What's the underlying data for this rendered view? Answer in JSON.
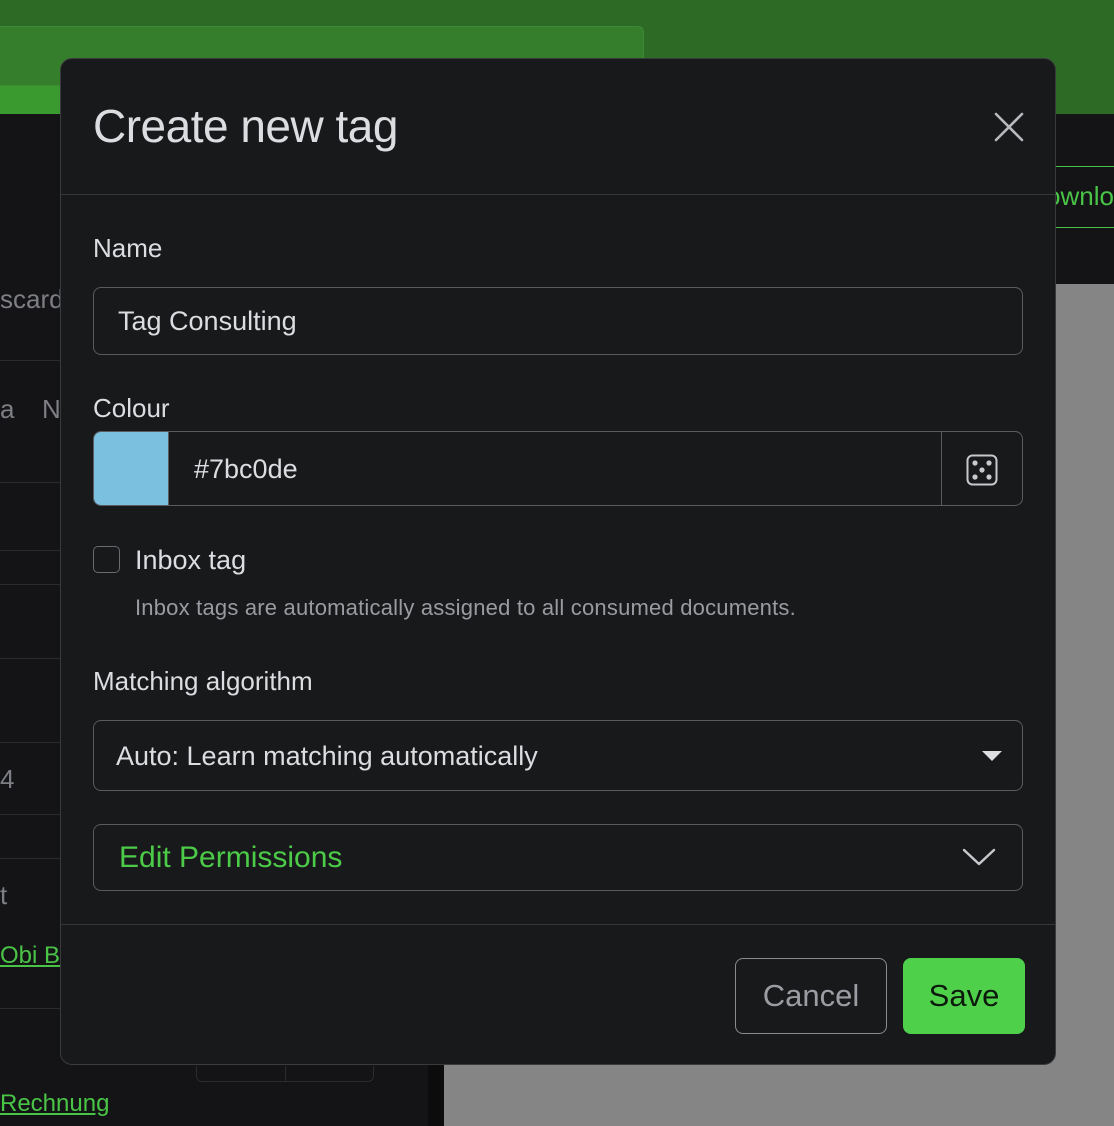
{
  "background": {
    "left_fragments": [
      "scard",
      "a",
      "N",
      "4",
      "t"
    ],
    "left_links": [
      "Obi Ba",
      "Rechnung"
    ],
    "right_button_fragment": "ownloa"
  },
  "modal": {
    "title": "Create new tag",
    "close_icon": "close-icon",
    "name": {
      "label": "Name",
      "value": "Tag Consulting"
    },
    "colour": {
      "label": "Colour",
      "value": "#7bc0de",
      "swatch_color": "#7bc0de",
      "random_icon": "dice-icon"
    },
    "inbox": {
      "label": "Inbox tag",
      "checked": false,
      "help": "Inbox tags are automatically assigned to all consumed documents."
    },
    "matching": {
      "label": "Matching algorithm",
      "selected": "Auto: Learn matching automatically"
    },
    "permissions": {
      "label": "Edit Permissions",
      "icon": "chevron-down-icon"
    },
    "footer": {
      "cancel_label": "Cancel",
      "save_label": "Save"
    }
  },
  "colors": {
    "accent": "#4fd04b",
    "topbar": "#2c6a25",
    "modal_bg": "#18191b"
  }
}
